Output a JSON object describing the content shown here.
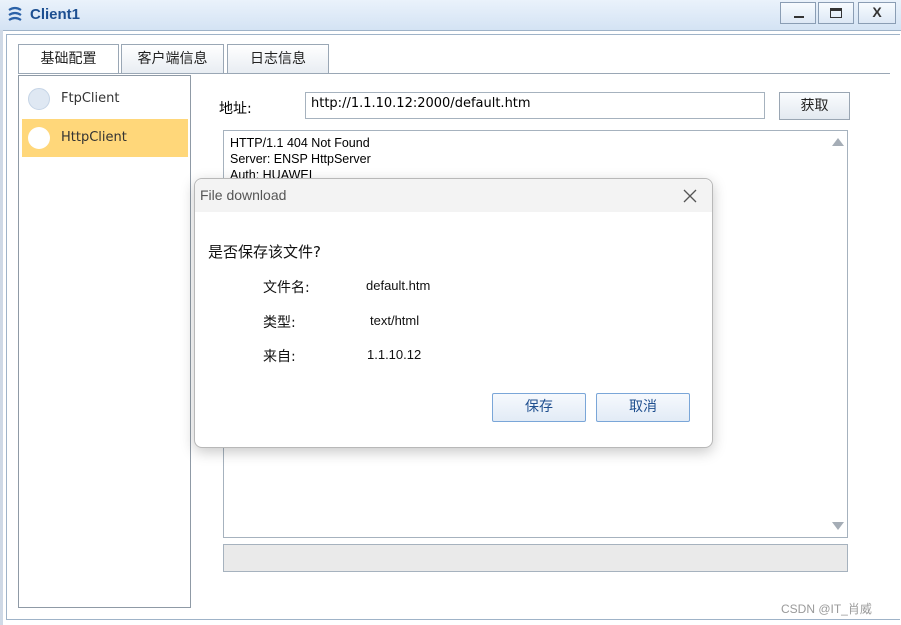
{
  "window": {
    "title": "Client1",
    "icon": "client-app-icon",
    "controls": {
      "minimize": "minimize-icon",
      "maximize": "maximize-icon",
      "close": "X"
    }
  },
  "tabs": [
    {
      "label": "基础配置"
    },
    {
      "label": "客户端信息"
    },
    {
      "label": "日志信息"
    }
  ],
  "client_list": [
    {
      "label": "FtpClient",
      "selected": false
    },
    {
      "label": "HttpClient",
      "selected": true
    }
  ],
  "http": {
    "address_label": "地址:",
    "address_value": "http://1.1.10.12:2000/default.htm",
    "fetch_button": "获取",
    "response_lines": [
      "HTTP/1.1 404 Not Found",
      "Server: ENSP HttpServer",
      "Auth: HUAWEI"
    ]
  },
  "dialog": {
    "title": "File download",
    "question": "是否保存该文件?",
    "rows": [
      {
        "label": "文件名:",
        "value": "default.htm"
      },
      {
        "label": "类型:",
        "value": "text/html"
      },
      {
        "label": "来自:",
        "value": "1.1.10.12"
      }
    ],
    "save_button": "保存",
    "cancel_button": "取消"
  },
  "watermark": "CSDN @IT_肖威",
  "colors": {
    "selected_item": "#ffd77a",
    "title_text": "#1d4f91",
    "dialog_button_text": "#1f4f8f"
  }
}
